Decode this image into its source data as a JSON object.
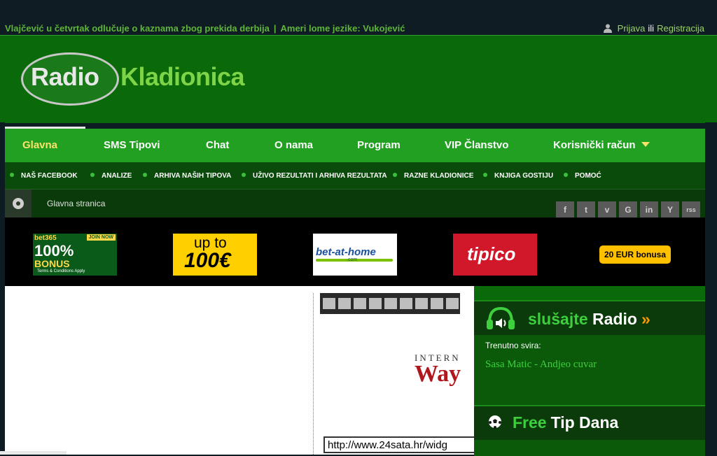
{
  "ticker": {
    "item1": "Vlajčević u četvrtak odlučuje o kaznama zbog prekida derbija",
    "separator": "|",
    "item2": "Ameri lome jezike: Vukojević"
  },
  "auth": {
    "login": "Prijava",
    "or": "ili",
    "register": "Registracija"
  },
  "logo": {
    "part1": "Radio",
    "part2": "Kladionica"
  },
  "nav": {
    "items": [
      "Glavna",
      "SMS Tipovi",
      "Chat",
      "O nama",
      "Program",
      "VIP Članstvo",
      "Korisnički račun"
    ],
    "active": "Glavna"
  },
  "subnav": {
    "items": [
      "NAŠ FACEBOOK",
      "ANALIZE",
      "ARHIVA NAŠIH TIPOVA",
      "UŽIVO REZULTATI I ARHIVA REZULTATA",
      "RAZNE KLADIONICE",
      "KNJIGA GOSTIJU",
      "POMOĆ"
    ]
  },
  "breadcrumb": {
    "current": "Glavna stranica"
  },
  "social": [
    "f",
    "t",
    "v",
    "G",
    "in",
    "Y",
    "rss"
  ],
  "ads": {
    "bet365": {
      "brand": "bet365",
      "line1": "100%",
      "line2": "BONUS",
      "terms": "Terms & Conditions Apply",
      "join": "JOIN NOW"
    },
    "upto": {
      "line1": "up to",
      "line2": "100€"
    },
    "betathome": {
      "brand": "bet-at-home",
      "sub": ".com"
    },
    "tipico": {
      "brand": "tipico"
    },
    "bonus": {
      "label": "20 EUR bonusa"
    }
  },
  "wayback": {
    "intern": "INTERN",
    "way": "WayBa",
    "url": "http://www.24sata.hr/widg"
  },
  "radio": {
    "title_green": "slušajte",
    "title_white": "Radio",
    "arrow": "»",
    "now_label": "Trenutno svira:",
    "song": "Sasa Matic - Andjeo cuvar"
  },
  "tip": {
    "title_green": "Free",
    "title_white": "Tip Dana"
  },
  "colors": {
    "brand_green": "#21a021",
    "dark_bg": "#0f1c24",
    "accent_yellow": "#fbe36a",
    "text_green": "#3ecf3e"
  }
}
